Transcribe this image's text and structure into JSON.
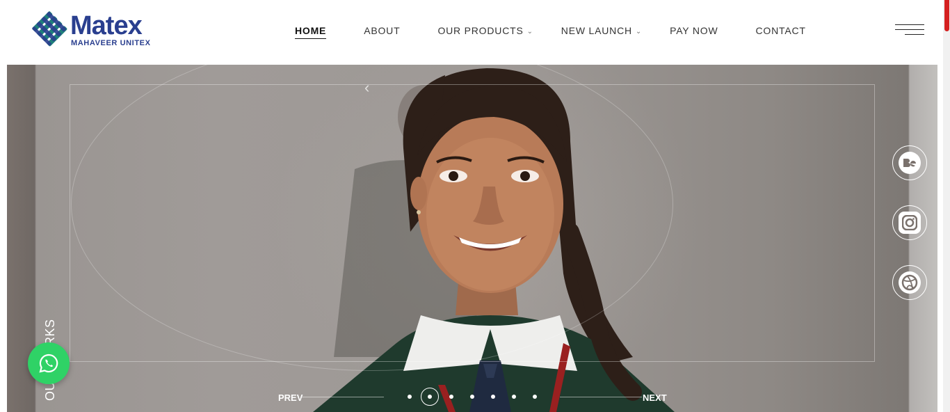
{
  "brand": {
    "name": "Matex",
    "tagline": "MAHAVEER UNITEX",
    "logo_icon": "woven-diamond-logo",
    "colors": {
      "navy": "#2a3f8f",
      "teal": "#1f7f7a"
    }
  },
  "nav": {
    "items": [
      {
        "label": "HOME",
        "active": true
      },
      {
        "label": "ABOUT"
      },
      {
        "label": "OUR PRODUCTS",
        "dropdown": true
      },
      {
        "label": "NEW LAUNCH",
        "dropdown": true
      },
      {
        "label": "PAY NOW"
      },
      {
        "label": "CONTACT"
      }
    ],
    "menu_icon": "hamburger-icon"
  },
  "hero": {
    "side_label": "OUR WORKS",
    "prev_label": "PREV",
    "next_label": "NEXT",
    "slide_count": 7,
    "active_slide": 2,
    "social_icons": [
      "behance-icon",
      "instagram-icon",
      "dribbble-icon"
    ]
  },
  "chat": {
    "icon": "whatsapp-icon",
    "color": "#2fd266"
  },
  "scrollbar": {
    "accent": "#d42020"
  }
}
